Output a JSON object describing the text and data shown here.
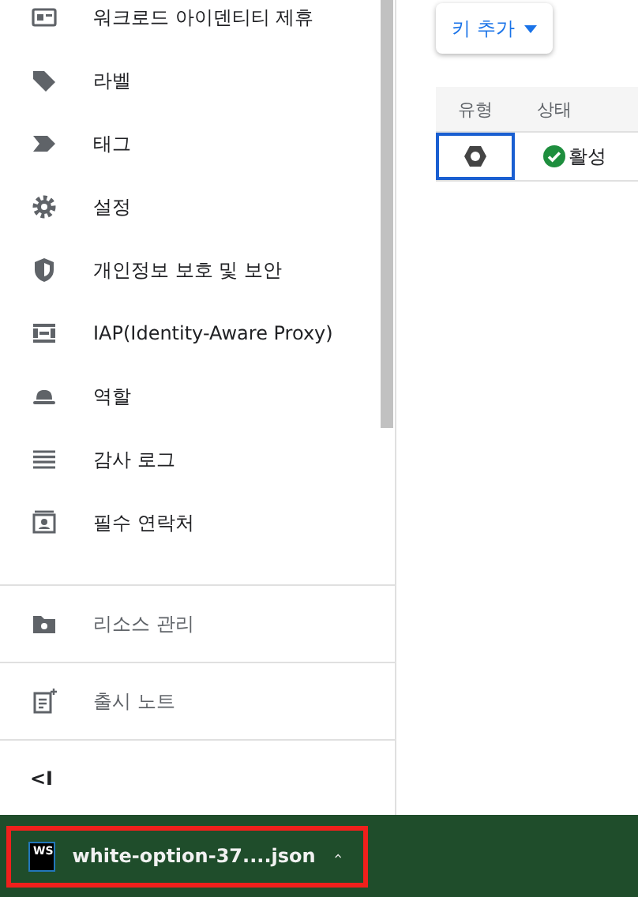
{
  "sidebar": {
    "items": [
      {
        "label": "워크로드 아이덴티티 제휴"
      },
      {
        "label": "라벨"
      },
      {
        "label": "태그"
      },
      {
        "label": "설정"
      },
      {
        "label": "개인정보 보호 및 보안"
      },
      {
        "label": "IAP(Identity-Aware Proxy)"
      },
      {
        "label": "역할"
      },
      {
        "label": "감사 로그"
      },
      {
        "label": "필수 연락처"
      }
    ],
    "footer_items": [
      {
        "label": "리소스 관리"
      },
      {
        "label": "출시 노트"
      }
    ],
    "collapse_label": "<I"
  },
  "add_key_button": "키 추가",
  "table": {
    "columns": [
      "유형",
      "상태"
    ],
    "rows": [
      {
        "status": "활성",
        "selected": true
      }
    ]
  },
  "download_bar": {
    "app_icon": "WS",
    "file": "white-option-37....json",
    "highlighted": true
  }
}
